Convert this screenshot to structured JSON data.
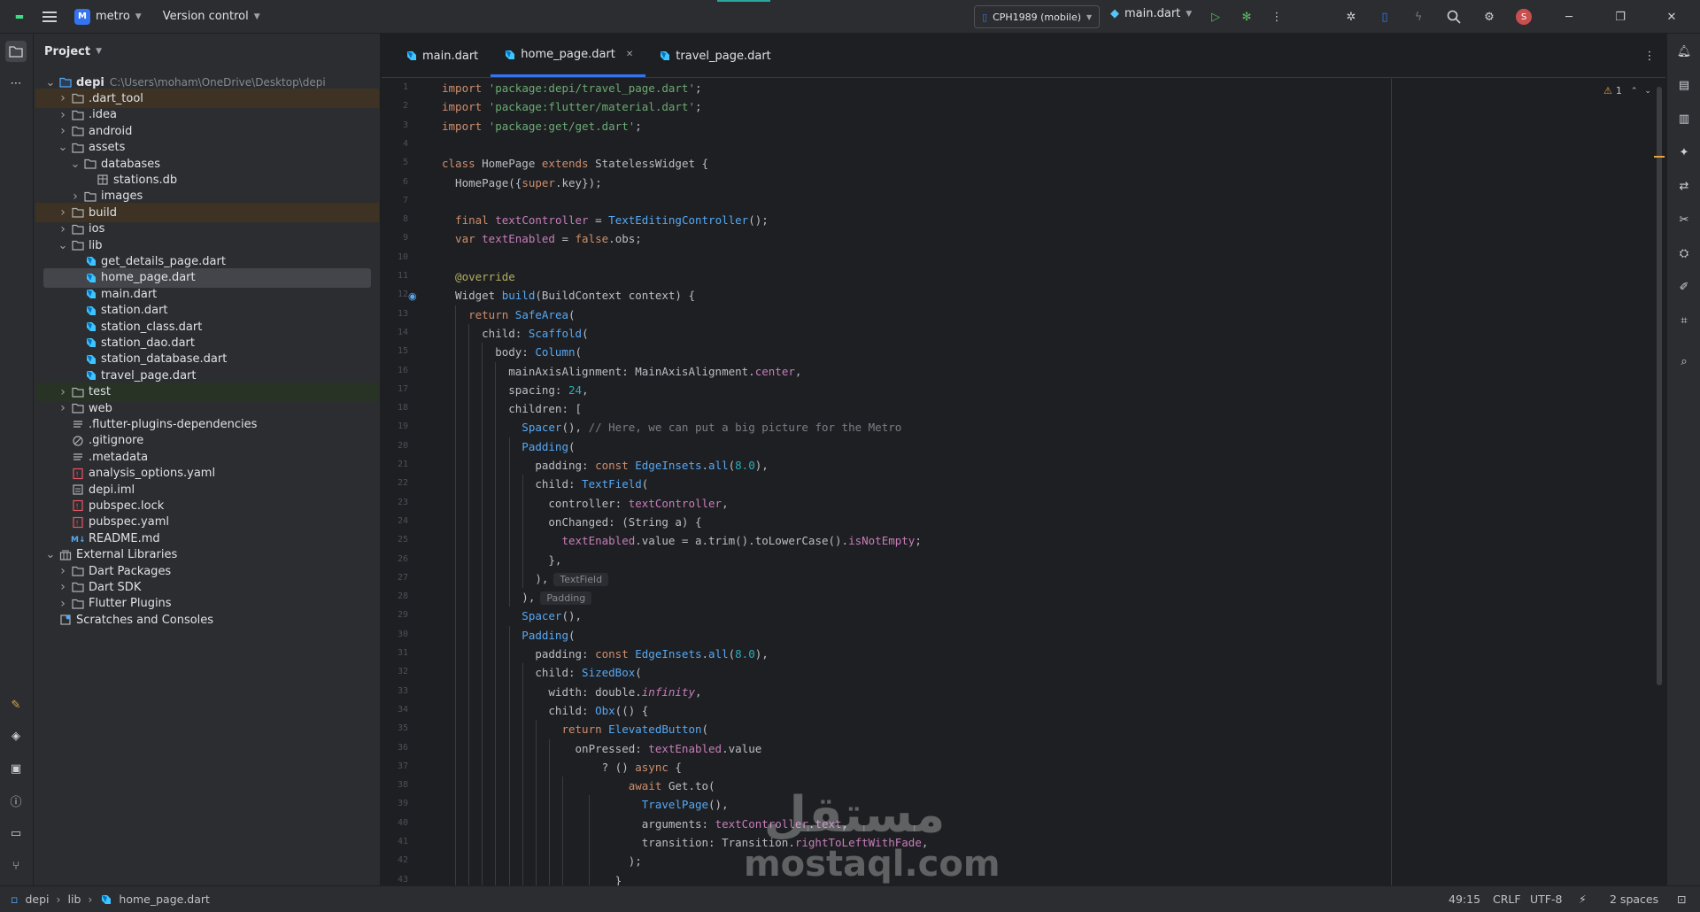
{
  "topbar": {
    "project_badge": "M",
    "project": "metro",
    "vcs": "Version control",
    "device": "CPH1989 (mobile)",
    "run_config": "main.dart",
    "avatar": "S"
  },
  "project_panel": {
    "title": "Project"
  },
  "tree": [
    {
      "label": "depi",
      "hint": "C:\\Users\\moham\\OneDrive\\Desktop\\depi",
      "depth": 0,
      "icon": "module-icon",
      "arrow": "open",
      "hl": ""
    },
    {
      "label": ".dart_tool",
      "depth": 1,
      "icon": "folder-icon",
      "arrow": "closed",
      "hl": "orange"
    },
    {
      "label": ".idea",
      "depth": 1,
      "icon": "folder-icon",
      "arrow": "closed",
      "hl": ""
    },
    {
      "label": "android",
      "depth": 1,
      "icon": "folder-icon",
      "arrow": "closed",
      "hl": ""
    },
    {
      "label": "assets",
      "depth": 1,
      "icon": "folder-icon",
      "arrow": "open",
      "hl": ""
    },
    {
      "label": "databases",
      "depth": 2,
      "icon": "folder-icon",
      "arrow": "open",
      "hl": ""
    },
    {
      "label": "stations.db",
      "depth": 3,
      "icon": "database-icon",
      "arrow": "none",
      "hl": ""
    },
    {
      "label": "images",
      "depth": 2,
      "icon": "folder-icon",
      "arrow": "closed",
      "hl": ""
    },
    {
      "label": "build",
      "depth": 1,
      "icon": "folder-icon",
      "arrow": "closed",
      "hl": "orange"
    },
    {
      "label": "ios",
      "depth": 1,
      "icon": "folder-icon",
      "arrow": "closed",
      "hl": ""
    },
    {
      "label": "lib",
      "depth": 1,
      "icon": "folder-icon",
      "arrow": "open",
      "hl": ""
    },
    {
      "label": "get_details_page.dart",
      "depth": 2,
      "icon": "dart-file-icon",
      "arrow": "none",
      "hl": ""
    },
    {
      "label": "home_page.dart",
      "depth": 2,
      "icon": "dart-file-icon",
      "arrow": "none",
      "hl": "sel"
    },
    {
      "label": "main.dart",
      "depth": 2,
      "icon": "dart-file-icon",
      "arrow": "none",
      "hl": ""
    },
    {
      "label": "station.dart",
      "depth": 2,
      "icon": "dart-file-icon",
      "arrow": "none",
      "hl": ""
    },
    {
      "label": "station_class.dart",
      "depth": 2,
      "icon": "dart-file-icon",
      "arrow": "none",
      "hl": ""
    },
    {
      "label": "station_dao.dart",
      "depth": 2,
      "icon": "dart-file-icon",
      "arrow": "none",
      "hl": ""
    },
    {
      "label": "station_database.dart",
      "depth": 2,
      "icon": "dart-file-icon",
      "arrow": "none",
      "hl": ""
    },
    {
      "label": "travel_page.dart",
      "depth": 2,
      "icon": "dart-file-icon",
      "arrow": "none",
      "hl": ""
    },
    {
      "label": "test",
      "depth": 1,
      "icon": "folder-icon",
      "arrow": "closed",
      "hl": "green"
    },
    {
      "label": "web",
      "depth": 1,
      "icon": "folder-icon",
      "arrow": "closed",
      "hl": ""
    },
    {
      "label": ".flutter-plugins-dependencies",
      "depth": 1,
      "icon": "text-file-icon",
      "arrow": "none",
      "hl": ""
    },
    {
      "label": ".gitignore",
      "depth": 1,
      "icon": "ignore-file-icon",
      "arrow": "none",
      "hl": ""
    },
    {
      "label": ".metadata",
      "depth": 1,
      "icon": "text-file-icon",
      "arrow": "none",
      "hl": ""
    },
    {
      "label": "analysis_options.yaml",
      "depth": 1,
      "icon": "yaml-file-icon",
      "arrow": "none",
      "hl": ""
    },
    {
      "label": "depi.iml",
      "depth": 1,
      "icon": "iml-file-icon",
      "arrow": "none",
      "hl": ""
    },
    {
      "label": "pubspec.lock",
      "depth": 1,
      "icon": "yaml-file-icon",
      "arrow": "none",
      "hl": ""
    },
    {
      "label": "pubspec.yaml",
      "depth": 1,
      "icon": "yaml-file-icon",
      "arrow": "none",
      "hl": ""
    },
    {
      "label": "README.md",
      "depth": 1,
      "icon": "markdown-file-icon",
      "arrow": "none",
      "hl": ""
    },
    {
      "label": "External Libraries",
      "depth": 0,
      "icon": "library-icon",
      "arrow": "open",
      "hl": ""
    },
    {
      "label": "Dart Packages",
      "depth": 1,
      "icon": "folder-icon",
      "arrow": "closed",
      "hl": ""
    },
    {
      "label": "Dart SDK",
      "depth": 1,
      "icon": "folder-icon",
      "arrow": "closed",
      "hl": ""
    },
    {
      "label": "Flutter Plugins",
      "depth": 1,
      "icon": "folder-icon",
      "arrow": "closed",
      "hl": ""
    },
    {
      "label": "Scratches and Consoles",
      "depth": 0,
      "icon": "scratch-icon",
      "arrow": "none",
      "hl": ""
    }
  ],
  "tabs": [
    {
      "label": "main.dart",
      "active": false
    },
    {
      "label": "home_page.dart",
      "active": true
    },
    {
      "label": "travel_page.dart",
      "active": false
    }
  ],
  "inspection": {
    "count": "1"
  },
  "code": [
    [
      [
        "kw",
        "import "
      ],
      [
        "str",
        "'package:depi/travel_page.dart'"
      ],
      [
        "",
        "; "
      ]
    ],
    [
      [
        "kw",
        "import "
      ],
      [
        "str",
        "'package:flutter/material.dart'"
      ],
      [
        "",
        ";"
      ]
    ],
    [
      [
        "kw",
        "import "
      ],
      [
        "str",
        "'package:get/get.dart'"
      ],
      [
        "",
        ";"
      ]
    ],
    [],
    [
      [
        "kw",
        "class "
      ],
      [
        "",
        "HomePage "
      ],
      [
        "kw",
        "extends "
      ],
      [
        "",
        "StatelessWidget {"
      ]
    ],
    [
      [
        "",
        "  HomePage({"
      ],
      [
        "kw",
        "super"
      ],
      [
        "",
        ".key});"
      ]
    ],
    [],
    [
      [
        "kw",
        "  final "
      ],
      [
        "fld",
        "textController "
      ],
      [
        "",
        "= "
      ],
      [
        "ty",
        "TextEditingController"
      ],
      [
        "",
        "();"
      ]
    ],
    [
      [
        "kw",
        "  var "
      ],
      [
        "fld",
        "textEnabled "
      ],
      [
        "",
        "= "
      ],
      [
        "kw",
        "false"
      ],
      [
        "",
        ".obs;"
      ]
    ],
    [],
    [
      [
        "ann",
        "  @override"
      ]
    ],
    [
      [
        "",
        "  Widget "
      ],
      [
        "ty",
        "build"
      ],
      [
        "",
        "(BuildContext context) {"
      ]
    ],
    [
      [
        "kw",
        "    return "
      ],
      [
        "ty",
        "SafeArea"
      ],
      [
        "",
        "("
      ]
    ],
    [
      [
        "",
        "      child: "
      ],
      [
        "ty",
        "Scaffold"
      ],
      [
        "",
        "("
      ]
    ],
    [
      [
        "",
        "        body: "
      ],
      [
        "ty",
        "Column"
      ],
      [
        "",
        "("
      ]
    ],
    [
      [
        "",
        "          mainAxisAlignment: MainAxisAlignment."
      ],
      [
        "fld",
        "center"
      ],
      [
        "",
        ","
      ]
    ],
    [
      [
        "",
        "          spacing: "
      ],
      [
        "num",
        "24"
      ],
      [
        "",
        ","
      ]
    ],
    [
      [
        "",
        "          children: ["
      ]
    ],
    [
      [
        "ty",
        "            Spacer"
      ],
      [
        "",
        "(), "
      ],
      [
        "cmt",
        "// Here, we can put a big picture for the Metro"
      ]
    ],
    [
      [
        "ty",
        "            Padding"
      ],
      [
        "",
        "("
      ]
    ],
    [
      [
        "",
        "              padding: "
      ],
      [
        "kw",
        "const "
      ],
      [
        "ty",
        "EdgeInsets"
      ],
      [
        "",
        "."
      ],
      [
        "ty",
        "all"
      ],
      [
        "",
        "("
      ],
      [
        "num",
        "8.0"
      ],
      [
        "",
        "),"
      ]
    ],
    [
      [
        "",
        "              child: "
      ],
      [
        "ty",
        "TextField"
      ],
      [
        "",
        "("
      ]
    ],
    [
      [
        "",
        "                controller: "
      ],
      [
        "fld",
        "textController"
      ],
      [
        "",
        ","
      ]
    ],
    [
      [
        "",
        "                onChanged: (String a) {"
      ]
    ],
    [
      [
        "fld",
        "                  textEnabled"
      ],
      [
        "",
        ".value = a.trim().toLowerCase()."
      ],
      [
        "fld",
        "isNotEmpty"
      ],
      [
        "",
        ";"
      ]
    ],
    [
      [
        "",
        "                },"
      ]
    ],
    [
      [
        "",
        "              ),"
      ],
      [
        "inlay",
        "TextField"
      ]
    ],
    [
      [
        "",
        "            ),"
      ],
      [
        "inlay",
        "Padding"
      ]
    ],
    [
      [
        "ty",
        "            Spacer"
      ],
      [
        "",
        "(),"
      ]
    ],
    [
      [
        "ty",
        "            Padding"
      ],
      [
        "",
        "("
      ]
    ],
    [
      [
        "",
        "              padding: "
      ],
      [
        "kw",
        "const "
      ],
      [
        "ty",
        "EdgeInsets"
      ],
      [
        "",
        "."
      ],
      [
        "ty",
        "all"
      ],
      [
        "",
        "("
      ],
      [
        "num",
        "8.0"
      ],
      [
        "",
        "),"
      ]
    ],
    [
      [
        "",
        "              child: "
      ],
      [
        "ty",
        "SizedBox"
      ],
      [
        "",
        "("
      ]
    ],
    [
      [
        "",
        "                width: double."
      ],
      [
        "it",
        "infinity"
      ],
      [
        "",
        ","
      ]
    ],
    [
      [
        "",
        "                child: "
      ],
      [
        "ty",
        "Obx"
      ],
      [
        "",
        "(() {"
      ]
    ],
    [
      [
        "kw",
        "                  return "
      ],
      [
        "ty",
        "ElevatedButton"
      ],
      [
        "",
        "("
      ]
    ],
    [
      [
        "",
        "                    onPressed: "
      ],
      [
        "fld",
        "textEnabled"
      ],
      [
        "",
        ".value"
      ]
    ],
    [
      [
        "",
        "                        ? () "
      ],
      [
        "kw",
        "async "
      ],
      [
        "",
        "{"
      ]
    ],
    [
      [
        "kw",
        "                            await "
      ],
      [
        "",
        "Get.to("
      ]
    ],
    [
      [
        "ty",
        "                              TravelPage"
      ],
      [
        "",
        "(),"
      ]
    ],
    [
      [
        "",
        "                              arguments: "
      ],
      [
        "fld",
        "textController"
      ],
      [
        "",
        "."
      ],
      [
        "fld",
        "text"
      ],
      [
        "",
        ","
      ]
    ],
    [
      [
        "",
        "                              transition: Transition."
      ],
      [
        "fld",
        "rightToLeftWithFade"
      ],
      [
        "",
        ","
      ]
    ],
    [
      [
        "",
        "                            );"
      ]
    ],
    [
      [
        "",
        "                          }"
      ]
    ]
  ],
  "statusbar": {
    "crumbs": [
      "depi",
      "lib",
      "home_page.dart"
    ],
    "pos": "49:15",
    "eol": "CRLF",
    "enc": "UTF-8",
    "indent": "2 spaces"
  },
  "watermark": {
    "arabic": "مستقل",
    "latin": "mostaql.com"
  },
  "colors": {
    "accent": "#3574f0",
    "bg": "#1e1f22",
    "panel": "#2b2d30"
  }
}
